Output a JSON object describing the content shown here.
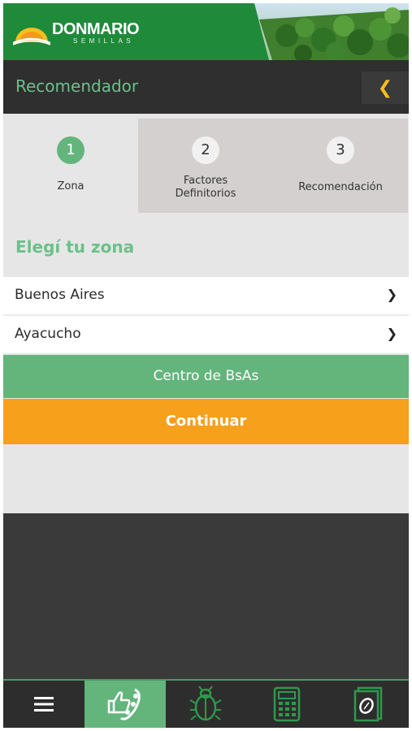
{
  "brand": {
    "name": "DONMARIO",
    "tagline": "SEMILLAS"
  },
  "header": {
    "title": "Recomendador",
    "back_icon": "chevron-left-icon"
  },
  "steps": [
    {
      "number": "1",
      "label": "Zona",
      "active": true
    },
    {
      "number": "2",
      "label_line1": "Factores",
      "label_line2": "Definitorios",
      "active": false
    },
    {
      "number": "3",
      "label": "Recomendación",
      "active": false
    }
  ],
  "zone": {
    "title": "Elegí tu zona",
    "province": "Buenos Aires",
    "district": "Ayacucho",
    "selected_zone": "Centro de BsAs",
    "continue_label": "Continuar"
  },
  "tabbar": {
    "tabs": [
      {
        "icon": "menu-icon",
        "active": false
      },
      {
        "icon": "soybean-thumbs-up-icon",
        "active": true
      },
      {
        "icon": "beetle-icon",
        "active": false
      },
      {
        "icon": "calculator-icon",
        "active": false
      },
      {
        "icon": "seed-bag-icon",
        "active": false
      }
    ]
  },
  "colors": {
    "brand_green": "#1f8a3a",
    "accent_green": "#63b57c",
    "title_green": "#6cc08a",
    "orange": "#f6a01c",
    "yellow": "#f4c01d",
    "dark": "#2f2f2f"
  }
}
